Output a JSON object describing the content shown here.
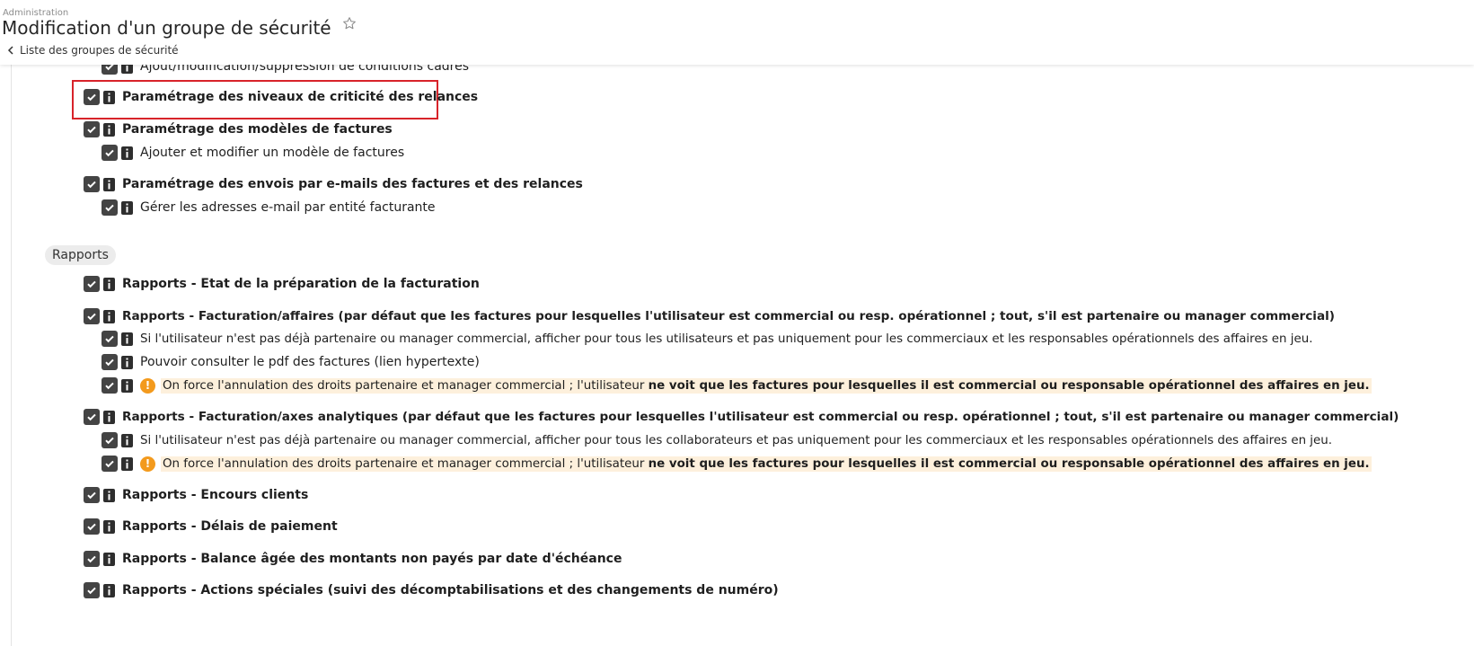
{
  "header": {
    "breadcrumb_top": "Administration",
    "title": "Modification d'un groupe de sécurité",
    "back_link": "Liste des groupes de sécurité"
  },
  "sections": {
    "rapports": "Rapports"
  },
  "rows": [
    {
      "label": "Ajout/modification/suppression de conditions cadres"
    },
    {
      "label": "Paramétrage des niveaux de criticité des relances"
    },
    {
      "label": "Paramétrage des modèles de factures"
    },
    {
      "label": "Ajouter et modifier un modèle de factures"
    },
    {
      "label": "Paramétrage des envois par e-mails des factures et des relances"
    },
    {
      "label": "Gérer les adresses e-mail par entité facturante"
    },
    {
      "label": "Rapports - Etat de la préparation de la facturation"
    },
    {
      "label": "Rapports - Facturation/affaires (par défaut que les factures pour lesquelles l'utilisateur est commercial ou resp. opérationnel ; tout, s'il est partenaire ou manager commercial)"
    },
    {
      "label": "Si l'utilisateur n'est pas déjà partenaire ou manager commercial, afficher pour tous les utilisateurs et pas uniquement pour les commerciaux et les responsables opérationnels des affaires en jeu."
    },
    {
      "label": "Pouvoir consulter le pdf des factures (lien hypertexte)"
    },
    {
      "warn_prefix": "On force l'annulation des droits partenaire et manager commercial ; l'utilisateur ",
      "warn_bold": "ne voit que les factures pour lesquelles il est commercial ou responsable opérationnel des affaires en jeu."
    },
    {
      "label": "Rapports - Facturation/axes analytiques (par défaut que les factures pour lesquelles l'utilisateur est commercial ou resp. opérationnel ; tout, s'il est partenaire ou manager commercial)"
    },
    {
      "label": "Si l'utilisateur n'est pas déjà partenaire ou manager commercial, afficher pour tous les collaborateurs et pas uniquement pour les commerciaux et les responsables opérationnels des affaires en jeu."
    },
    {
      "warn_prefix": "On force l'annulation des droits partenaire et manager commercial ; l'utilisateur ",
      "warn_bold": "ne voit que les factures pour lesquelles il est commercial ou responsable opérationnel des affaires en jeu."
    },
    {
      "label": "Rapports - Encours clients"
    },
    {
      "label": "Rapports - Délais de paiement"
    },
    {
      "label": "Rapports - Balance âgée des montants non payés par date d'échéance"
    },
    {
      "label": "Rapports - Actions spéciales (suivi des décomptabilisations et des changements de numéro)"
    }
  ],
  "warn_glyph": "!",
  "colors": {
    "checkbox": "#444444",
    "highlight_border": "#d8232a",
    "warning": "#f39a1d",
    "warning_bg": "#fdf0dc"
  }
}
